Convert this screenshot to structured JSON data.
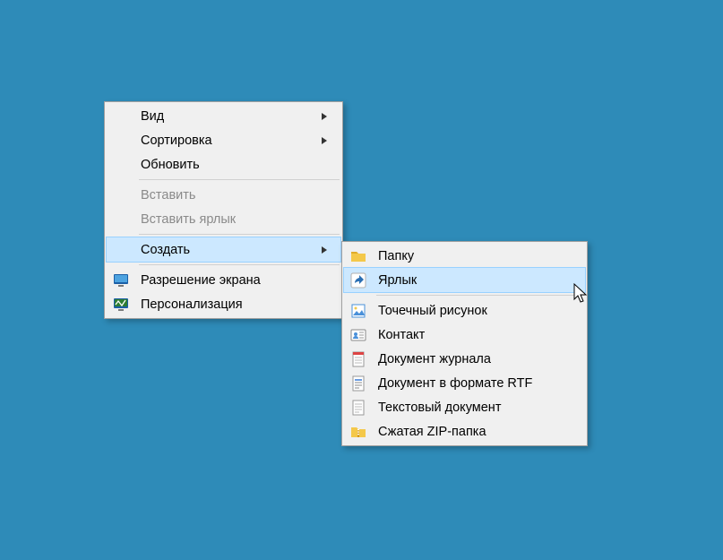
{
  "mainMenu": {
    "view": {
      "label": "Вид"
    },
    "sort": {
      "label": "Сортировка"
    },
    "refresh": {
      "label": "Обновить"
    },
    "paste": {
      "label": "Вставить"
    },
    "pasteShortcut": {
      "label": "Вставить ярлык"
    },
    "create": {
      "label": "Создать"
    },
    "resolution": {
      "label": "Разрешение экрана"
    },
    "personalize": {
      "label": "Персонализация"
    }
  },
  "subMenu": {
    "folder": {
      "label": "Папку"
    },
    "shortcut": {
      "label": "Ярлык"
    },
    "bitmap": {
      "label": "Точечный рисунок"
    },
    "contact": {
      "label": "Контакт"
    },
    "journal": {
      "label": "Документ журнала"
    },
    "rtf": {
      "label": "Документ в формате RTF"
    },
    "text": {
      "label": "Текстовый документ"
    },
    "zip": {
      "label": "Сжатая ZIP-папка"
    }
  }
}
